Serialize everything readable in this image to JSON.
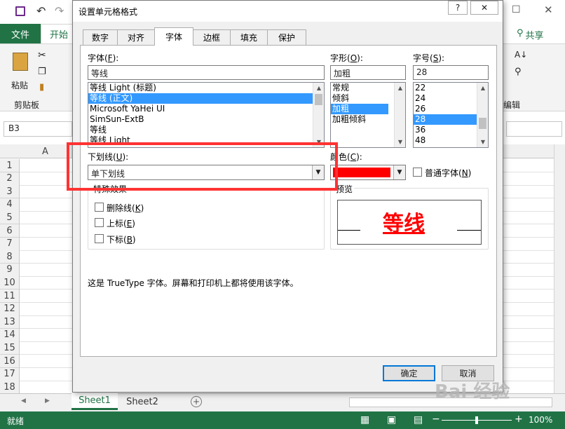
{
  "excel": {
    "tabs": {
      "file": "文件",
      "home": "开始",
      "share": "共享"
    },
    "ribbon": {
      "paste": "粘贴",
      "clipboard": "剪贴板",
      "edit": "编辑"
    },
    "namebox": "B3",
    "column_header": "A",
    "rows": [
      "1",
      "2",
      "3",
      "4",
      "5",
      "6",
      "7",
      "8",
      "9",
      "10",
      "11",
      "12",
      "13",
      "14",
      "15",
      "16",
      "17",
      "18"
    ],
    "sheets": [
      "Sheet1",
      "Sheet2"
    ],
    "status": "就绪",
    "zoom": "100%"
  },
  "dialog": {
    "title": "设置单元格格式",
    "help": "?",
    "close": "✕",
    "tabs": [
      "数字",
      "对齐",
      "字体",
      "边框",
      "填充",
      "保护"
    ],
    "active_tab": "字体",
    "font_label": "字体(F):",
    "font_label_main": "字体(",
    "font_label_key": "F",
    "font_label_end": "):",
    "font_value": "等线",
    "font_list": [
      "等线 Light (标题)",
      "等线 (正文)",
      "Microsoft YaHei UI",
      "SimSun-ExtB",
      "等线",
      "等线 Light"
    ],
    "style_label_main": "字形(",
    "style_label_key": "O",
    "style_label_end": "):",
    "style_value": "加粗",
    "style_list": [
      "常规",
      "倾斜",
      "加粗",
      "加粗倾斜"
    ],
    "size_label_main": "字号(",
    "size_label_key": "S",
    "size_label_end": "):",
    "size_value": "28",
    "size_list": [
      "22",
      "24",
      "26",
      "28",
      "36",
      "48"
    ],
    "underline_label_main": "下划线(",
    "underline_label_key": "U",
    "underline_label_end": "):",
    "underline_value": "单下划线",
    "color_label_main": "颜色(",
    "color_label_key": "C",
    "color_label_end": "):",
    "color_value": "#ff0000",
    "normal_font_main": "普通字体(",
    "normal_font_key": "N",
    "normal_font_end": ")",
    "effects_label": "特殊效果",
    "strikethrough_main": "删除线(",
    "strikethrough_key": "K",
    "superscript_main": "上标(",
    "superscript_key": "E",
    "subscript_main": "下标(",
    "subscript_key": "B",
    "paren_close": ")",
    "preview_label": "预览",
    "preview_text": "等线",
    "description": "这是 TrueType 字体。屏幕和打印机上都将使用该字体。",
    "ok": "确定",
    "cancel": "取消"
  },
  "watermark": "Bai 经验"
}
